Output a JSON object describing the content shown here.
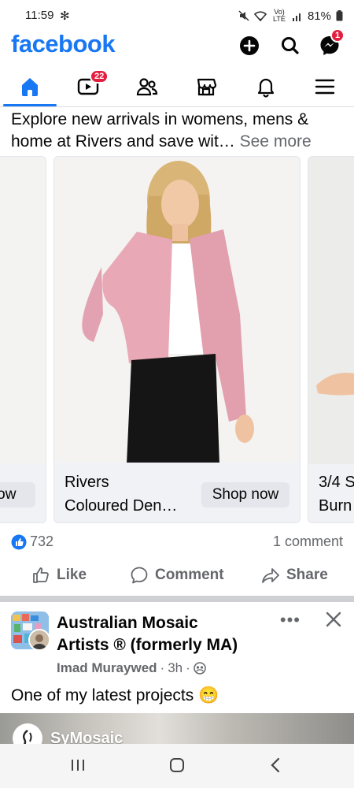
{
  "status_bar": {
    "time": "11:59",
    "pin_icon": "pinwheel-icon",
    "network": "Vo) LTE",
    "battery": "81%"
  },
  "header": {
    "logo": "facebook",
    "messenger_badge": "1"
  },
  "nav": {
    "tabs": [
      "home",
      "video",
      "friends",
      "marketplace",
      "notifications",
      "menu"
    ],
    "active": "home",
    "video_badge": "22"
  },
  "ad_post": {
    "text": "Explore new arrivals in womens, mens & home at Rivers and save wit… ",
    "see_more": "See more",
    "cards": [
      {
        "title": "Rivers",
        "subtitle": "Coloured Den…",
        "cta": "Shop now"
      },
      {
        "title": "3/4 S",
        "subtitle": "Burn",
        "cta": ""
      },
      {
        "title": "",
        "subtitle": "",
        "cta": "now"
      }
    ],
    "like_count": "732",
    "comment_count": "1 comment",
    "actions": {
      "like": "Like",
      "comment": "Comment",
      "share": "Share"
    }
  },
  "next_post": {
    "group_line1": "Australian Mosaic",
    "group_line2": "Artists ® (formerly MA)",
    "author": "Imad Muraywed",
    "time": "3h",
    "text": "One of my latest projects 😁",
    "media_tag": "SyMosaic"
  },
  "colors": {
    "brand": "#1877f2",
    "badge": "#e41e3f",
    "secondary_text": "#65676b"
  }
}
